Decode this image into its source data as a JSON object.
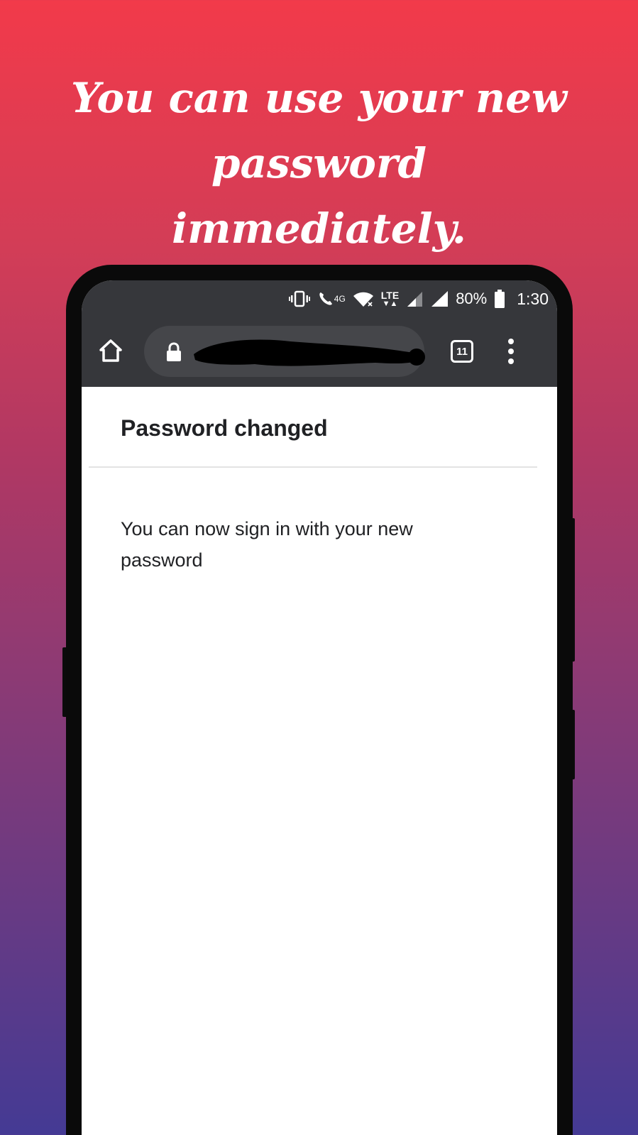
{
  "promo": {
    "line1": "You can use your new password",
    "line2": "immediately."
  },
  "statusbar": {
    "network_label": "4G",
    "lte_label": "LTE",
    "battery": "80%",
    "time": "1:30"
  },
  "toolbar": {
    "tab_count": "11"
  },
  "page": {
    "title": "Password changed",
    "message": "You can now sign in with your new password"
  },
  "colors": {
    "gradient_top": "#f23a4a",
    "gradient_bottom": "#443a94",
    "browser_chrome": "#36373b",
    "urlbar": "#45464a"
  }
}
